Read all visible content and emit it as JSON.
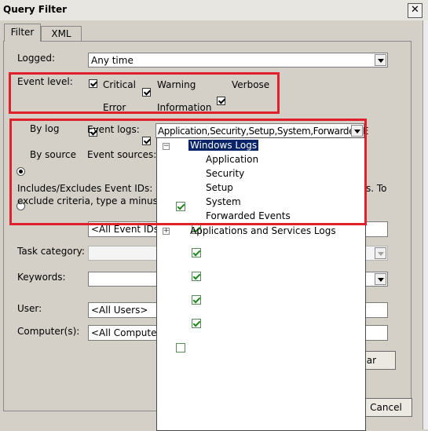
{
  "window": {
    "title": "Query Filter",
    "close_glyph": "✕"
  },
  "tabs": [
    {
      "label": "Filter"
    },
    {
      "label": "XML"
    }
  ],
  "logged": {
    "label": "Logged:",
    "value": "Any time"
  },
  "event_level": {
    "label": "Event level:",
    "items": [
      {
        "label": "Critical",
        "checked": true
      },
      {
        "label": "Warning",
        "checked": true
      },
      {
        "label": "Verbose",
        "checked": true
      },
      {
        "label": "Error",
        "checked": true
      },
      {
        "label": "Information",
        "checked": true
      }
    ]
  },
  "by_log": {
    "label": "By log",
    "selected": true
  },
  "by_source": {
    "label": "By source",
    "selected": false
  },
  "event_logs": {
    "label": "Event logs:",
    "value": "Application,Security,Setup,System,Forwarded E"
  },
  "event_sources": {
    "label": "Event sources:"
  },
  "event_ids": {
    "desc_line1_left": "Includes/Excludes Event IDs: Ente",
    "desc_line1_right": "s. To",
    "desc_line2_left": "exclude criteria, type a minus sign",
    "value": "<All Event IDs>"
  },
  "task_category": {
    "label": "Task category:"
  },
  "keywords": {
    "label": "Keywords:"
  },
  "user": {
    "label": "User:",
    "value": "<All Users>"
  },
  "computers": {
    "label": "Computer(s):",
    "value": "<All Computers"
  },
  "buttons": {
    "clear_partial": "ear",
    "cancel": "Cancel"
  },
  "tree": {
    "windows_logs": {
      "label": "Windows Logs",
      "checked": true,
      "expander": "−",
      "children": [
        {
          "label": "Application",
          "checked": true
        },
        {
          "label": "Security",
          "checked": true
        },
        {
          "label": "Setup",
          "checked": true
        },
        {
          "label": "System",
          "checked": true
        },
        {
          "label": "Forwarded Events",
          "checked": true
        }
      ]
    },
    "app_services": {
      "label": "Applications and Services Logs",
      "checked": false,
      "expander": "+"
    }
  }
}
